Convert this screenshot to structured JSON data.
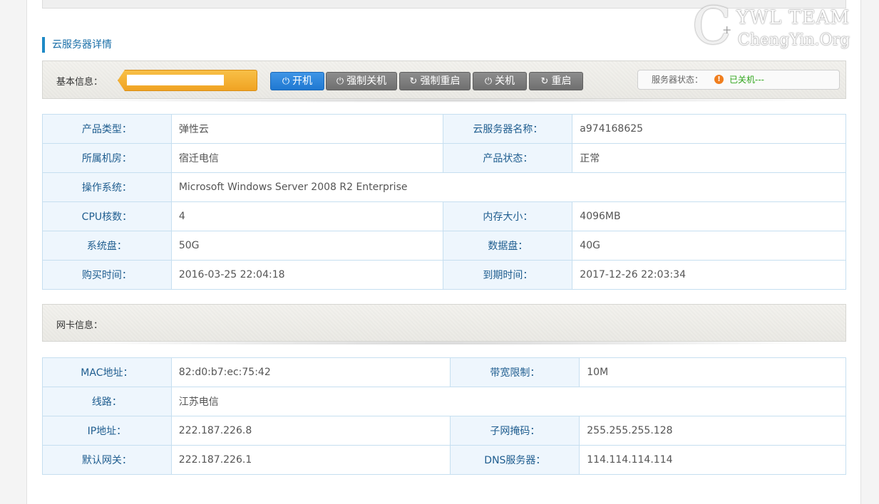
{
  "watermark": {
    "line1": "YWL TEAM",
    "line2": "ChengYin.Org",
    "symbol": "C",
    "plus": "+"
  },
  "section_title": "云服务器详情",
  "basic_bar": {
    "label": "基本信息：",
    "buttons": [
      {
        "id": "power-on",
        "label": "开机",
        "icon": "power-icon"
      },
      {
        "id": "force-shutdown",
        "label": "强制关机",
        "icon": "power-icon"
      },
      {
        "id": "force-restart",
        "label": "强制重启",
        "icon": "refresh-icon"
      },
      {
        "id": "shutdown",
        "label": "关机",
        "icon": "power-icon"
      },
      {
        "id": "restart",
        "label": "重启",
        "icon": "refresh-icon"
      }
    ],
    "status_label": "服务器状态：",
    "status_value": "已关机---",
    "colors": {
      "status": "#2fa51a",
      "primary_button": "#1f78d1",
      "warning_icon": "#f07e1e"
    }
  },
  "server_info": [
    [
      {
        "k": "产品类型：",
        "v": "弹性云"
      },
      {
        "k": "云服务器名称：",
        "v": "a974168625"
      }
    ],
    [
      {
        "k": "所属机房：",
        "v": "宿迁电信"
      },
      {
        "k": "产品状态：",
        "v": "正常"
      }
    ],
    [
      {
        "k": "操作系统：",
        "v": "Microsoft Windows Server 2008 R2 Enterprise"
      }
    ],
    [
      {
        "k": "CPU核数：",
        "v": "4"
      },
      {
        "k": "内存大小：",
        "v": "4096MB"
      }
    ],
    [
      {
        "k": "系统盘：",
        "v": "50G"
      },
      {
        "k": "数据盘：",
        "v": "40G"
      }
    ],
    [
      {
        "k": "购买时间：",
        "v": "2016-03-25 22:04:18"
      },
      {
        "k": "到期时间：",
        "v": "2017-12-26 22:03:34"
      }
    ]
  ],
  "nic_bar": {
    "label": "网卡信息："
  },
  "nic_info": [
    [
      {
        "k": "MAC地址：",
        "v": "82:d0:b7:ec:75:42"
      },
      {
        "k": "带宽限制：",
        "v": "10M"
      }
    ],
    [
      {
        "k": "线路：",
        "v": "江苏电信"
      }
    ],
    [
      {
        "k": "IP地址：",
        "v": "222.187.226.8"
      },
      {
        "k": "子网掩码：",
        "v": "255.255.255.128"
      }
    ],
    [
      {
        "k": "默认网关：",
        "v": "222.187.226.1"
      },
      {
        "k": "DNS服务器：",
        "v": "114.114.114.114"
      }
    ]
  ]
}
